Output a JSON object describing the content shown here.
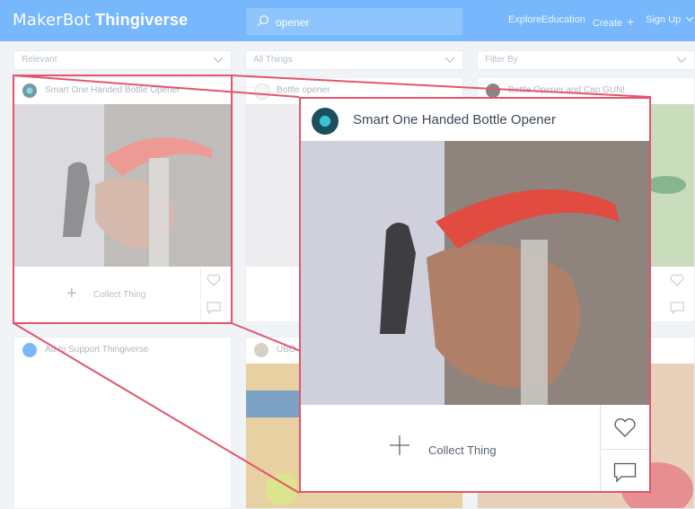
{
  "header": {
    "logo_brand": "MakerBot",
    "logo_site": "Thingiverse",
    "search_value": "opener",
    "nav": {
      "explore": "Explore",
      "education": "Education",
      "create": "Create",
      "create_icon": "plus-icon",
      "signup": "Sign Up"
    }
  },
  "filters": {
    "sort": "Relevant",
    "type": "All Things",
    "filter": "Filter By"
  },
  "cards": [
    {
      "title": "Smart One Handed Bottle Opener",
      "collect_label": "Collect Thing"
    },
    {
      "title": "Bottle opener"
    },
    {
      "title": "Bottle Opener and Cap GUN!"
    },
    {
      "title": "Ad to Support Thingiverse"
    },
    {
      "title": "UBO"
    }
  ],
  "zoom": {
    "title": "Smart One Handed Bottle Opener",
    "collect_label": "Collect Thing",
    "icons": [
      "plus-icon",
      "heart-icon",
      "comment-icon"
    ]
  },
  "colors": {
    "header_bg": "#248bfb",
    "highlight": "#e2556d",
    "opener_red": "#e24b3f"
  }
}
